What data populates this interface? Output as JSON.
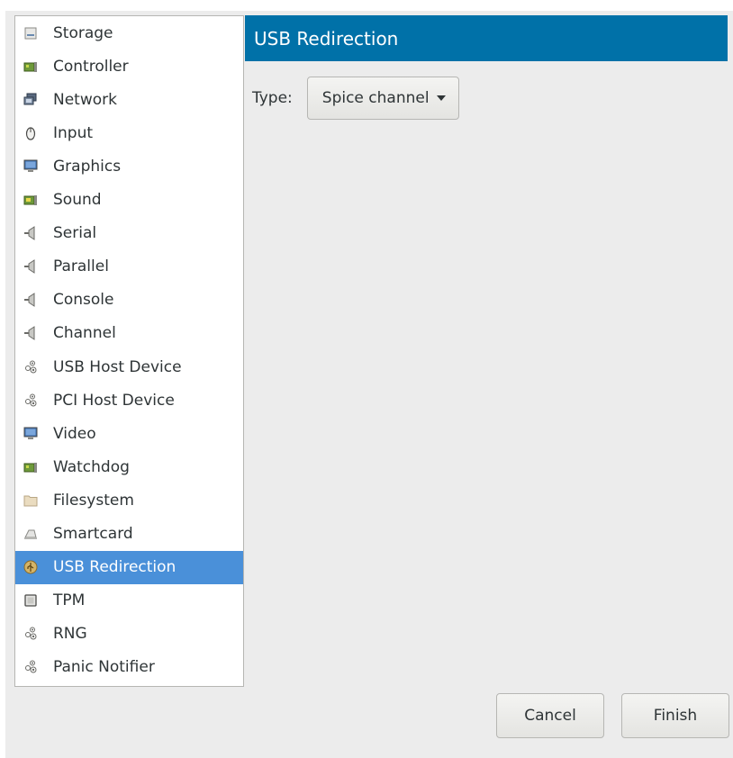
{
  "sidebar": {
    "items": [
      {
        "label": "Storage",
        "icon": "storage-icon"
      },
      {
        "label": "Controller",
        "icon": "controller-icon"
      },
      {
        "label": "Network",
        "icon": "network-icon"
      },
      {
        "label": "Input",
        "icon": "mouse-icon"
      },
      {
        "label": "Graphics",
        "icon": "monitor-icon"
      },
      {
        "label": "Sound",
        "icon": "sound-card-icon"
      },
      {
        "label": "Serial",
        "icon": "serial-port-icon"
      },
      {
        "label": "Parallel",
        "icon": "parallel-port-icon"
      },
      {
        "label": "Console",
        "icon": "console-port-icon"
      },
      {
        "label": "Channel",
        "icon": "channel-port-icon"
      },
      {
        "label": "USB Host Device",
        "icon": "usb-host-icon"
      },
      {
        "label": "PCI Host Device",
        "icon": "pci-host-icon"
      },
      {
        "label": "Video",
        "icon": "video-icon"
      },
      {
        "label": "Watchdog",
        "icon": "watchdog-icon"
      },
      {
        "label": "Filesystem",
        "icon": "folder-icon"
      },
      {
        "label": "Smartcard",
        "icon": "smartcard-icon"
      },
      {
        "label": "USB Redirection",
        "icon": "usb-redirection-icon",
        "selected": true
      },
      {
        "label": "TPM",
        "icon": "chip-icon"
      },
      {
        "label": "RNG",
        "icon": "rng-icon"
      },
      {
        "label": "Panic Notifier",
        "icon": "panic-notifier-icon"
      }
    ]
  },
  "panel": {
    "title": "USB Redirection",
    "type_label": "Type:",
    "type_value": "Spice channel"
  },
  "buttons": {
    "cancel": "Cancel",
    "finish": "Finish"
  },
  "colors": {
    "header_bg": "#0071a8",
    "selected_bg": "#4a90d9",
    "window_bg": "#ececec"
  }
}
